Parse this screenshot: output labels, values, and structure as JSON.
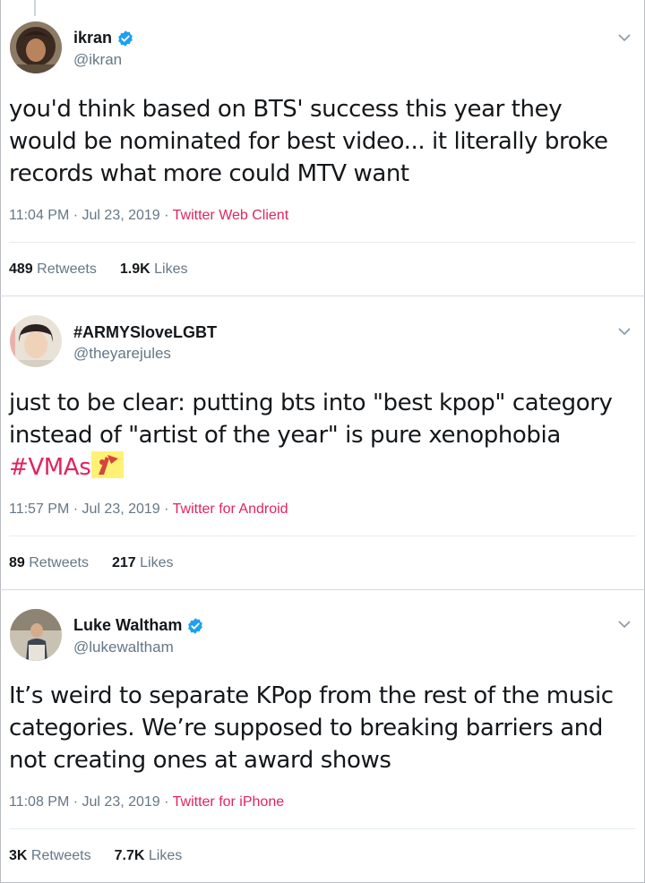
{
  "tweets": [
    {
      "name": "ikran",
      "handle": "@ikran",
      "verified": true,
      "text": "you'd think based on BTS' success this year they would be nominated for best video... it literally broke records what more could MTV want",
      "time": "11:04 PM · Jul 23, 2019 · ",
      "source": "Twitter Web Client",
      "retweets": "489",
      "retweets_label": "Retweets",
      "likes": "1.9K",
      "likes_label": "Likes"
    },
    {
      "name": "#ARMYSloveLGBT",
      "handle": "@theyarejules",
      "verified": false,
      "text": "just to be clear: putting bts into \"best kpop\" category instead of \"artist of the year\" is pure xenophobia",
      "hashtag": "#VMAs",
      "time": "11:57 PM · Jul 23, 2019 · ",
      "source": "Twitter for Android",
      "retweets": "89",
      "retweets_label": "Retweets",
      "likes": "217",
      "likes_label": "Likes"
    },
    {
      "name": "Luke Waltham",
      "handle": "@lukewaltham",
      "verified": true,
      "text": "It’s weird to separate KPop from the rest of the music categories. We’re supposed to breaking barriers and not creating ones at award shows",
      "time": "11:08 PM · Jul 23, 2019 · ",
      "source": "Twitter for iPhone",
      "retweets": "3K",
      "retweets_label": "Retweets",
      "likes": "7.7K",
      "likes_label": "Likes"
    }
  ],
  "colors": {
    "link": "#e0245e",
    "verified": "#1da1f2",
    "muted": "#657786"
  },
  "icons": {
    "verified": "verified-badge-icon",
    "menu": "chevron-down-icon"
  }
}
